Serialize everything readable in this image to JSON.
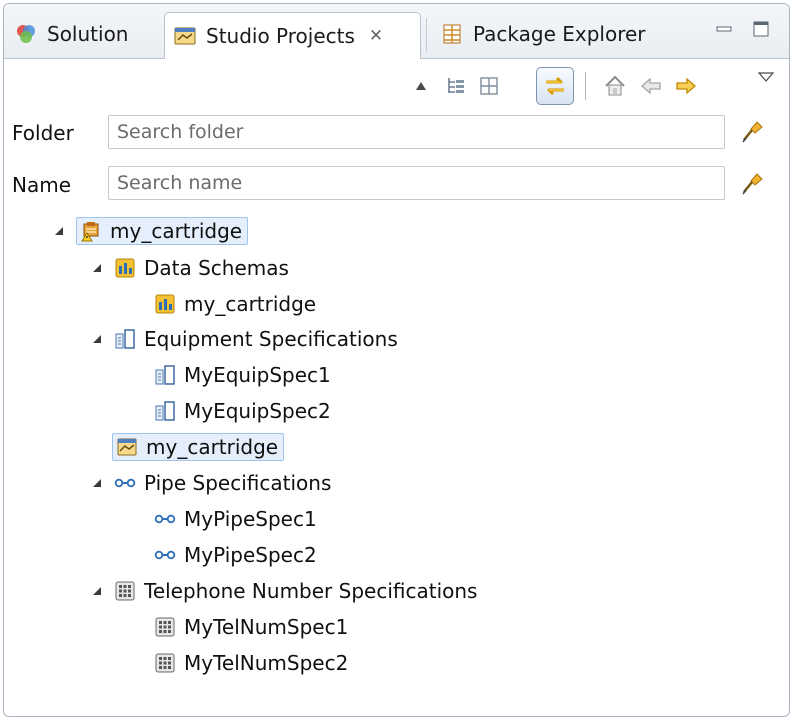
{
  "tabs": [
    {
      "label": "Solution",
      "icon": "solution-icon",
      "active": false
    },
    {
      "label": "Studio Projects",
      "icon": "studio-projects-icon",
      "active": true,
      "close": "✕"
    },
    {
      "label": "Package Explorer",
      "icon": "package-explorer-icon",
      "active": false
    }
  ],
  "window_controls": [
    "minimize-icon",
    "maximize-icon"
  ],
  "toolbar": [
    "collapse-up-icon",
    "tree-view-icon",
    "grid-view-icon",
    "link-with-editor-icon",
    "home-icon",
    "back-icon",
    "forward-icon",
    "view-menu-icon"
  ],
  "filters": {
    "folder": {
      "label": "Folder",
      "placeholder": "Search folder",
      "value": ""
    },
    "name": {
      "label": "Name",
      "placeholder": "Search name",
      "value": ""
    }
  },
  "tree": [
    {
      "label": "my_cartridge",
      "icon": "cartridge-warning-icon",
      "expanded": true,
      "selected": true
    },
    {
      "label": "Data Schemas",
      "icon": "data-schema-icon",
      "expanded": true
    },
    {
      "label": "my_cartridge",
      "icon": "data-schema-icon"
    },
    {
      "label": "Equipment Specifications",
      "icon": "equipment-spec-icon",
      "expanded": true
    },
    {
      "label": "MyEquipSpec1",
      "icon": "equipment-spec-icon"
    },
    {
      "label": "MyEquipSpec2",
      "icon": "equipment-spec-icon"
    },
    {
      "label": "my_cartridge",
      "icon": "project-icon",
      "selected": true
    },
    {
      "label": "Pipe Specifications",
      "icon": "pipe-spec-icon",
      "expanded": true
    },
    {
      "label": "MyPipeSpec1",
      "icon": "pipe-spec-icon"
    },
    {
      "label": "MyPipeSpec2",
      "icon": "pipe-spec-icon"
    },
    {
      "label": "Telephone Number Specifications",
      "icon": "telephone-number-spec-icon",
      "expanded": true
    },
    {
      "label": "MyTelNumSpec1",
      "icon": "telephone-number-spec-icon"
    },
    {
      "label": "MyTelNumSpec2",
      "icon": "telephone-number-spec-icon"
    }
  ],
  "colors": {
    "accent": "#f0a800",
    "selection": "#e4effb",
    "tab_border": "#b9c3cf"
  }
}
